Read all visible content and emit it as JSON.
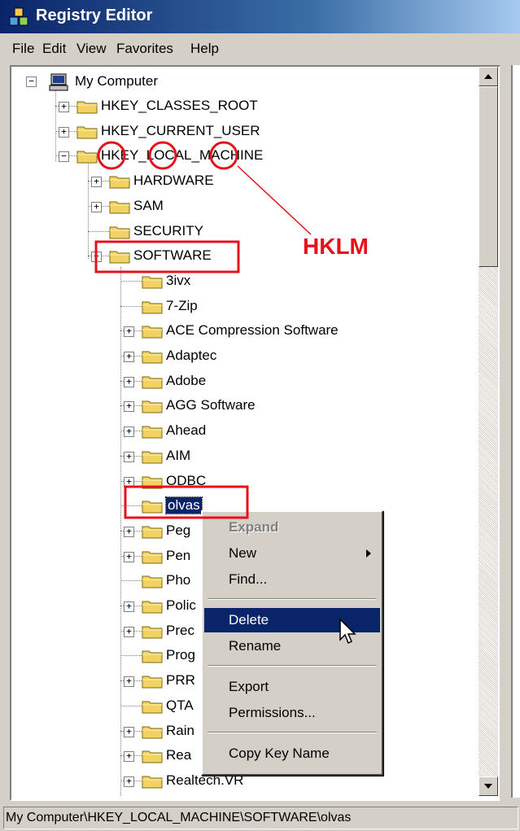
{
  "window": {
    "title": "Registry Editor",
    "app_icon": "registry-editor-icon"
  },
  "menu": {
    "items": [
      "File",
      "Edit",
      "View",
      "Favorites",
      "Help"
    ]
  },
  "tree": {
    "root": {
      "label": "My Computer",
      "icon": "computer-icon"
    },
    "hives": [
      "HKEY_CLASSES_ROOT",
      "HKEY_CURRENT_USER",
      "HKEY_LOCAL_MACHINE"
    ],
    "hklm_children": [
      "HARDWARE",
      "SAM",
      "SECURITY",
      "SOFTWARE"
    ],
    "software_children": [
      "3ivx",
      "7-Zip",
      "ACE Compression Software",
      "Adaptec",
      "Adobe",
      "AGG Software",
      "Ahead",
      "AIM",
      "ODBC",
      "olvas",
      "Peg",
      "Pen",
      "Pho",
      "Polic",
      "Prec",
      "Prog",
      "PRR",
      "QTA",
      "Rain",
      "Rea",
      "Realtech.VR"
    ],
    "selected": "olvas"
  },
  "context_menu": {
    "items": [
      "Expand",
      "New",
      "Find...",
      "Delete",
      "Rename",
      "Export",
      "Permissions...",
      "Copy Key Name"
    ],
    "disabled": "Expand",
    "highlighted": "Delete",
    "has_submenu": "New"
  },
  "annotation": {
    "label": "HKLM",
    "color": "#e8101a"
  },
  "status_bar": {
    "path": "My Computer\\HKEY_LOCAL_MACHINE\\SOFTWARE\\olvas"
  },
  "colors": {
    "selection": "#0a246a",
    "annotation": "#e8101a",
    "folder": "#f2d262"
  }
}
